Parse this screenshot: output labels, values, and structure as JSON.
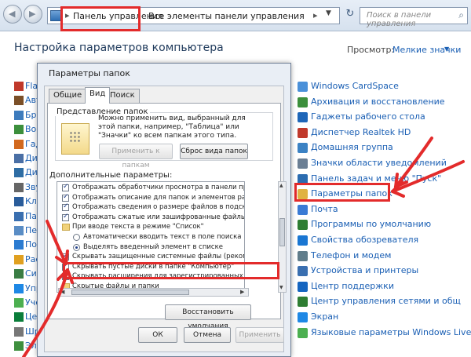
{
  "nav": {
    "back_icon": "back-arrow-icon",
    "forward_icon": "forward-arrow-icon"
  },
  "address": {
    "crumb_root": "Панель управления",
    "crumb_current": "Все элементы панели управления",
    "separator": "▸"
  },
  "search": {
    "placeholder": "Поиск в панели управления"
  },
  "header": {
    "title": "Настройка параметров компьютера",
    "view_label": "Просмотр:",
    "view_value": "Мелкие значки"
  },
  "left_items": [
    "Flash",
    "Авто",
    "Бра",
    "Вос",
    "Гад",
    "Дис",
    "Дис",
    "Зву",
    "Кла",
    "Пан",
    "Пер",
    "Пол",
    "Рас",
    "Сис",
    "Упр",
    "Уче",
    "Цен",
    "Шр",
    "Эле"
  ],
  "right_items": [
    "Windows CardSpace",
    "Архивация и восстановление",
    "Гаджеты рабочего стола",
    "Диспетчер Realtek HD",
    "Домашняя группа",
    "Значки области уведомлений",
    "Панель задач и меню \"Пуск\"",
    "Параметры папок",
    "Почта",
    "Программы по умолчанию",
    "Свойства обозревателя",
    "Телефон и модем",
    "Устройства и принтеры",
    "Центр поддержки",
    "Центр управления сетями и общ",
    "Экран",
    "Языковые параметры Windows Live"
  ],
  "dialog": {
    "title": "Параметры папок",
    "tabs": [
      "Общие",
      "Вид",
      "Поиск"
    ],
    "active_tab": "Вид",
    "group_title": "Представление папок",
    "group_desc": "Можно применить вид, выбранный для этой папки, например, \"Таблица\" или \"Значки\" ко всем папкам этого типа.",
    "apply_button": "Применить к папкам",
    "reset_button": "Сброс вида папок",
    "advanced_label": "Дополнительные параметры:",
    "advanced_items": [
      {
        "text": "Отображать обработчики просмотра в панели просм",
        "type": "checkbox",
        "checked": true
      },
      {
        "text": "Отображать описание для папок и элементов рабочег",
        "type": "checkbox",
        "checked": true
      },
      {
        "text": "Отображать сведения о размере файлов в подсказк",
        "type": "checkbox",
        "checked": true
      },
      {
        "text": "Отображать сжатые или зашифрованные файлы NTI",
        "type": "checkbox",
        "checked": true
      },
      {
        "text": "При вводе текста в режиме \"Список\"",
        "type": "folder",
        "checked": false
      },
      {
        "text": "Автоматически вводить текст в поле поиска",
        "type": "radio",
        "checked": false
      },
      {
        "text": "Выделять введенный элемент в списке",
        "type": "radio",
        "checked": true
      },
      {
        "text": "Скрывать защищенные системные файлы (рекомен",
        "type": "checkbox",
        "checked": true
      },
      {
        "text": "Скрывать пустые диски в папке \"Компьютер\"",
        "type": "checkbox",
        "checked": true
      },
      {
        "text": "Скрывать расширения для зарегистрированных типов файлов",
        "type": "checkbox",
        "checked": true
      },
      {
        "text": "Скрытые файлы и папки",
        "type": "folder",
        "checked": false
      }
    ],
    "restore_button": "Восстановить умолчания",
    "ok_button": "ОК",
    "cancel_button": "Отмена",
    "apply_dialog_button": "Применить"
  },
  "colors": {
    "highlight_red": "#e32b2b",
    "link_blue": "#1a5fb4"
  }
}
